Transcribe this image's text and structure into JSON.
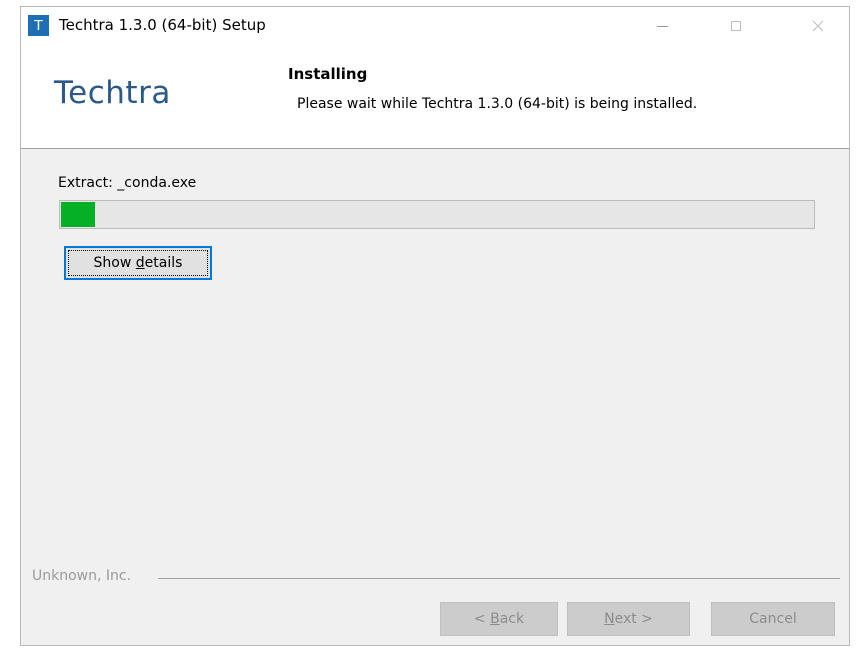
{
  "window": {
    "title": "Techtra 1.3.0 (64-bit) Setup",
    "app_icon_letter": "T",
    "icons": {
      "app": "app-t-icon",
      "minimize": "minimize-icon",
      "maximize": "maximize-icon",
      "close": "close-icon"
    }
  },
  "header": {
    "brand": "Techtra",
    "title": "Installing",
    "subtitle": "Please wait while Techtra 1.3.0 (64-bit) is being installed."
  },
  "progress": {
    "status_text": "Extract: _conda.exe",
    "fraction": 0.045,
    "fill_color": "#06b025"
  },
  "details_button": {
    "label": "Show details"
  },
  "footer": {
    "company": "Unknown, Inc.",
    "back_label": "< Back",
    "next_label": "Next >",
    "cancel_label": "Cancel"
  },
  "colors": {
    "brand": "#2b5a88",
    "focus": "#0078d7",
    "app_icon": "#1d6eb2"
  }
}
